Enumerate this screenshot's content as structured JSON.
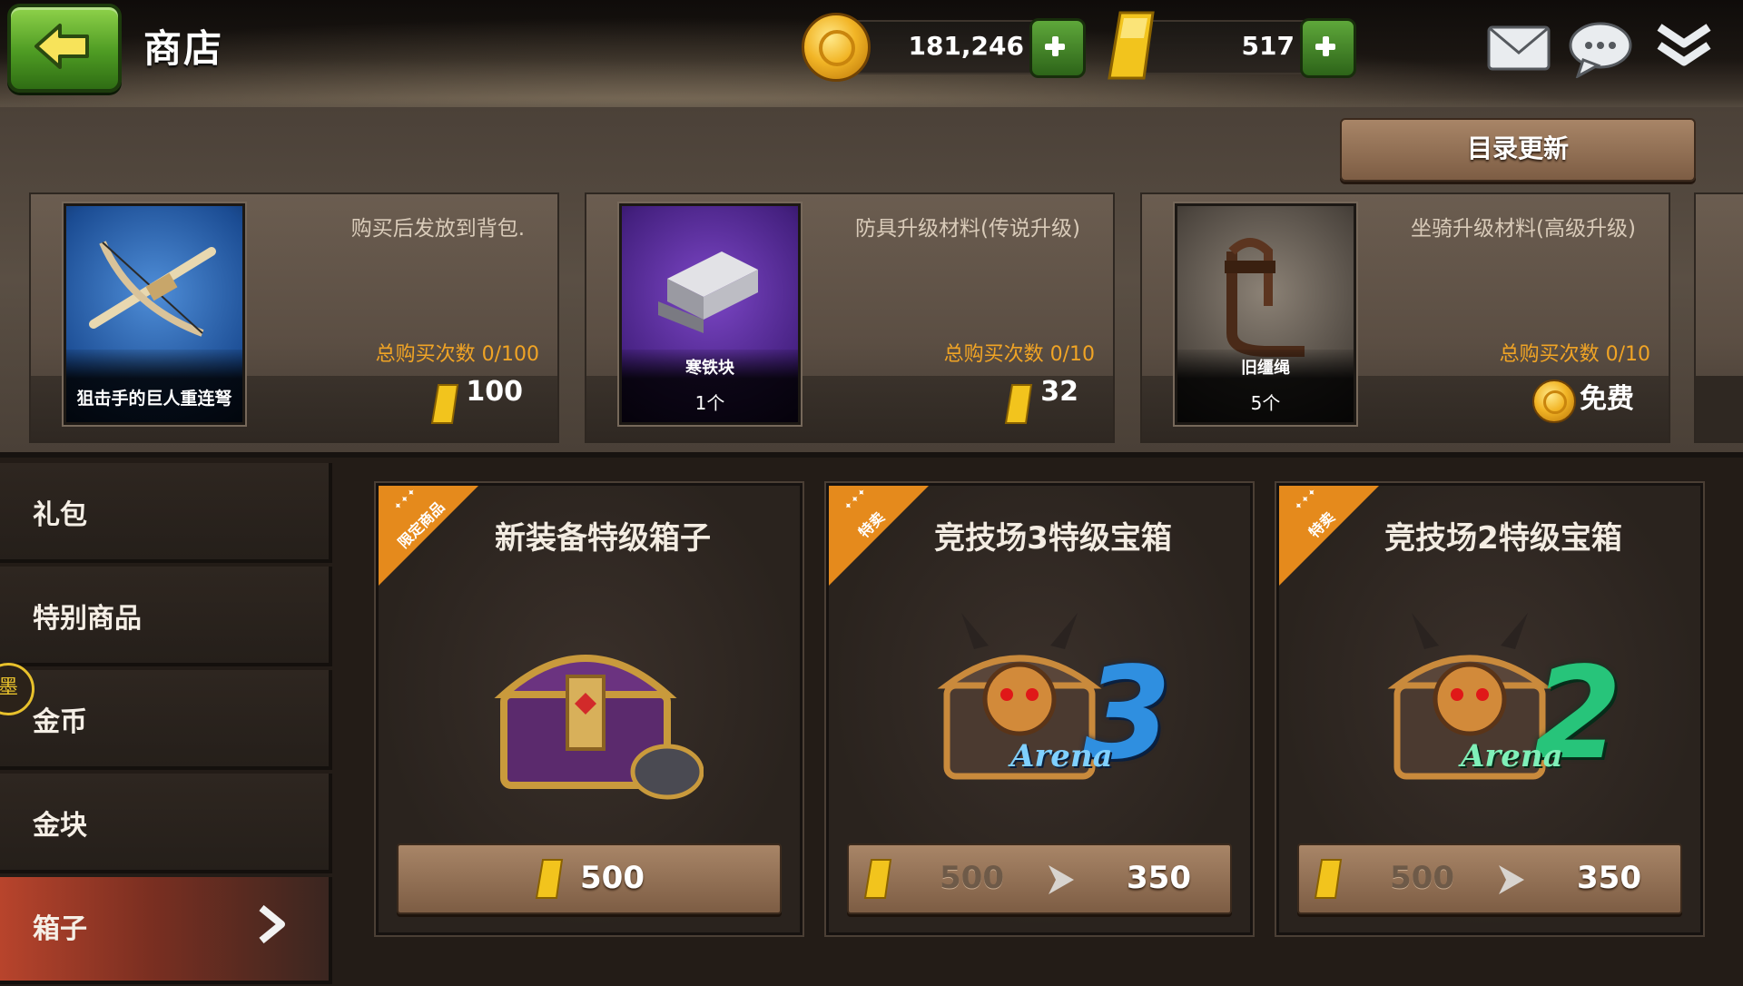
{
  "header": {
    "title": "商店",
    "gold_coins": "181,246",
    "gold_bars": "517"
  },
  "refresh_button": "目录更新",
  "offers": [
    {
      "item_name": "狙击手的巨人重连弩",
      "quantity": "",
      "description": "购买后发放到背包.",
      "purchase_limit": "总购买次数 0/100",
      "price": "100",
      "currency_icon": "gold-bar-icon",
      "thumb_color": "#1b4c93"
    },
    {
      "item_name": "寒铁块",
      "quantity": "1个",
      "description": "防具升级材料(传说升级)",
      "purchase_limit": "总购买次数 0/10",
      "price": "32",
      "currency_icon": "gold-bar-icon",
      "thumb_color": "#44207f"
    },
    {
      "item_name": "旧缰绳",
      "quantity": "5个",
      "description": "坐骑升级材料(高级升级)",
      "purchase_limit": "总购买次数 0/10",
      "price": "免费",
      "currency_icon": "gold-coin-icon",
      "thumb_color": "#4d463f"
    }
  ],
  "sidebar": {
    "items": [
      {
        "label": "礼包",
        "active": false
      },
      {
        "label": "特别商品",
        "active": false
      },
      {
        "label": "金币",
        "active": false
      },
      {
        "label": "金块",
        "active": false
      },
      {
        "label": "箱子",
        "active": true
      }
    ],
    "badge": "墨"
  },
  "boxes": [
    {
      "title": "新装备特级箱子",
      "ribbon": "限定商品",
      "price": "500",
      "original_price": "",
      "discount_price": ""
    },
    {
      "title": "竞技场3特级宝箱",
      "ribbon": "特卖",
      "price": "",
      "original_price": "500",
      "discount_price": "350",
      "badge_number": "3",
      "badge_word": "Arena",
      "badge_color": "#2f8fe0"
    },
    {
      "title": "竞技场2特级宝箱",
      "ribbon": "特卖",
      "price": "",
      "original_price": "500",
      "discount_price": "350",
      "badge_number": "2",
      "badge_word": "Arena",
      "badge_color": "#27c47a"
    }
  ],
  "colors": {
    "accent_orange": "#e58a1c",
    "limit_text": "#f0a425",
    "active_tab": "#b8442c",
    "button_brown": "#a88567"
  }
}
